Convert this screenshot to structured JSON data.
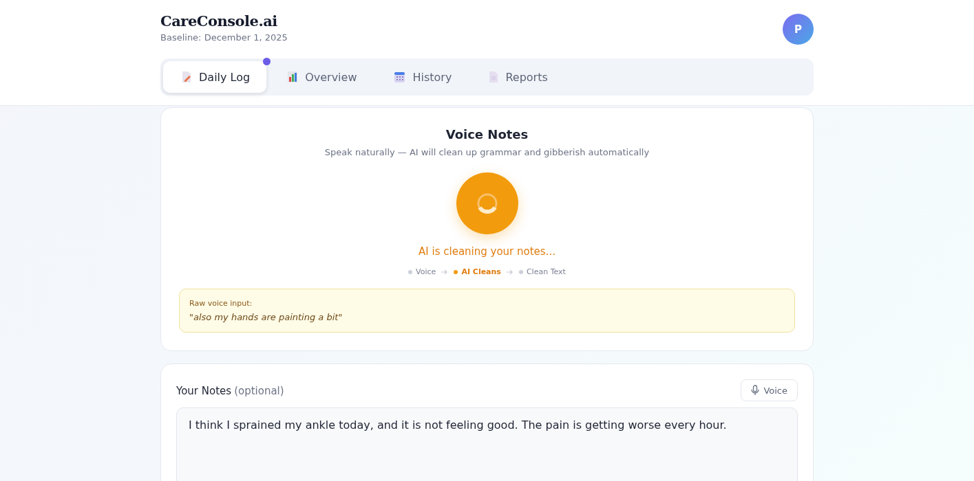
{
  "header": {
    "brand": "CareConsole.ai",
    "baseline": "Baseline: December 1, 2025",
    "avatar": "P"
  },
  "tabs": [
    {
      "label": "Daily Log",
      "kind": "memo",
      "selected": true,
      "notification": true
    },
    {
      "label": "Overview",
      "kind": "chart",
      "selected": false,
      "notification": false
    },
    {
      "label": "History",
      "kind": "calendar",
      "selected": false,
      "notification": false
    },
    {
      "label": "Reports",
      "kind": "page",
      "selected": false,
      "notification": false
    }
  ],
  "voice_card": {
    "title": "Voice Notes",
    "subtitle": "Speak naturally — AI will clean up grammar and gibberish automatically",
    "status": "AI is cleaning your notes...",
    "steps": [
      {
        "label": "Voice",
        "active": false
      },
      {
        "label": "AI Cleans",
        "active": true
      },
      {
        "label": "Clean Text",
        "active": false
      }
    ],
    "raw_label": "Raw voice input:",
    "raw_text": "\"also my hands are painting a bit\""
  },
  "notes": {
    "label": "Your Notes",
    "hint": "(optional)",
    "voice_button": "Voice",
    "value": "I think I sprained my ankle today, and it is not feeling good. The pain is getting worse every hour."
  }
}
